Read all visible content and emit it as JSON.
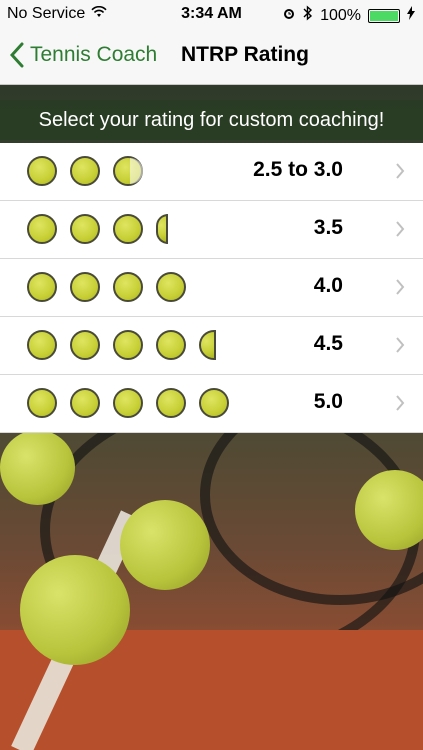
{
  "status": {
    "carrier": "No Service",
    "time": "3:34 AM",
    "battery": "100%"
  },
  "nav": {
    "back_label": "Tennis Coach",
    "title": "NTRP Rating"
  },
  "header": {
    "text": "Select your rating for custom coaching!"
  },
  "ratings": [
    {
      "label": "2.5 to 3.0",
      "balls": 3
    },
    {
      "label": "3.5",
      "balls": 3.5
    },
    {
      "label": "4.0",
      "balls": 4
    },
    {
      "label": "4.5",
      "balls": 4.5
    },
    {
      "label": "5.0",
      "balls": 5
    }
  ],
  "colors": {
    "accent": "#2e7d32",
    "ball": "#c7cf35",
    "header_bg": "#3a4a32"
  },
  "icons": [
    "wifi-icon",
    "alarm-icon",
    "bluetooth-icon",
    "battery-icon",
    "chevron-left-icon",
    "chevron-right-icon",
    "tennis-ball-icon"
  ]
}
